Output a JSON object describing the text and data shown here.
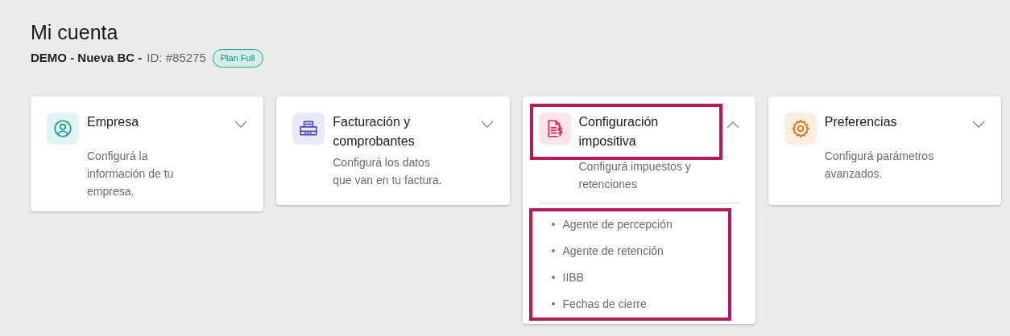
{
  "page": {
    "title": "Mi cuenta",
    "company": "DEMO - Nueva BC -",
    "account_id": "ID: #85275",
    "plan_badge": "Plan Full"
  },
  "cards": [
    {
      "color": "#14a38b",
      "title": "Empresa",
      "description": "Configurá la\ninformación de tu\nempresa.",
      "expanded": false,
      "highlighted": false
    },
    {
      "color": "#4f46c8",
      "title": "Facturación y\ncomprobantes",
      "description": "Configurá los datos\nque van en tu factura.",
      "expanded": false,
      "highlighted": false
    },
    {
      "color": "#e8225c",
      "title": "Configuración\nimpositiva",
      "description": "Configurá impuestos y\nretenciones",
      "expanded": true,
      "highlighted": true,
      "items": [
        "Agente de percepción",
        "Agente de retención",
        "IIBB",
        "Fechas de cierre"
      ]
    },
    {
      "color": "#d9730d",
      "title": "Preferencias",
      "description": "Configurá parámetros\navanzados.",
      "expanded": false,
      "highlighted": false
    }
  ]
}
